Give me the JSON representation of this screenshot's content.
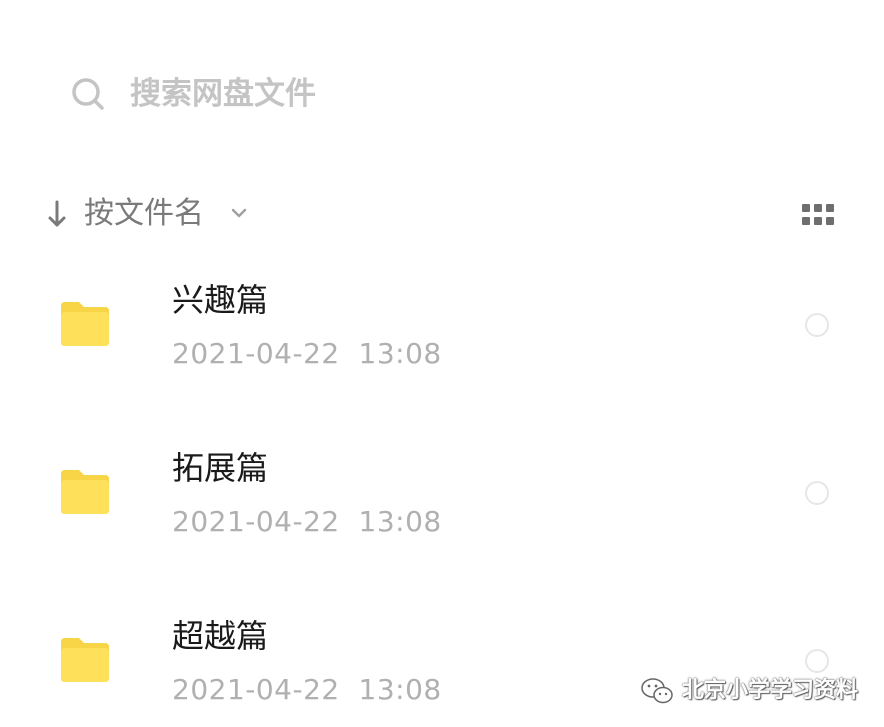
{
  "search": {
    "placeholder": "搜索网盘文件"
  },
  "sort": {
    "label": "按文件名",
    "direction": "descending"
  },
  "icons": {
    "search": "search-icon",
    "sort": "arrow-down-icon",
    "sort_menu": "chevron-down-icon",
    "view_toggle": "grid-view-icon",
    "folder": "folder-icon",
    "select": "radio-circle-icon",
    "watermark": "wechat-icon"
  },
  "colors": {
    "folder": "#FFE05A",
    "folder_tab": "#F7D546",
    "text_primary": "#1a1a1a",
    "text_secondary": "#b0b0b0"
  },
  "files": [
    {
      "name": "兴趣篇",
      "date": "2021-04-22",
      "time": "13:08"
    },
    {
      "name": "拓展篇",
      "date": "2021-04-22",
      "time": "13:08"
    },
    {
      "name": "超越篇",
      "date": "2021-04-22",
      "time": "13:08"
    }
  ],
  "watermark": {
    "text": "北京小学学习资料"
  }
}
